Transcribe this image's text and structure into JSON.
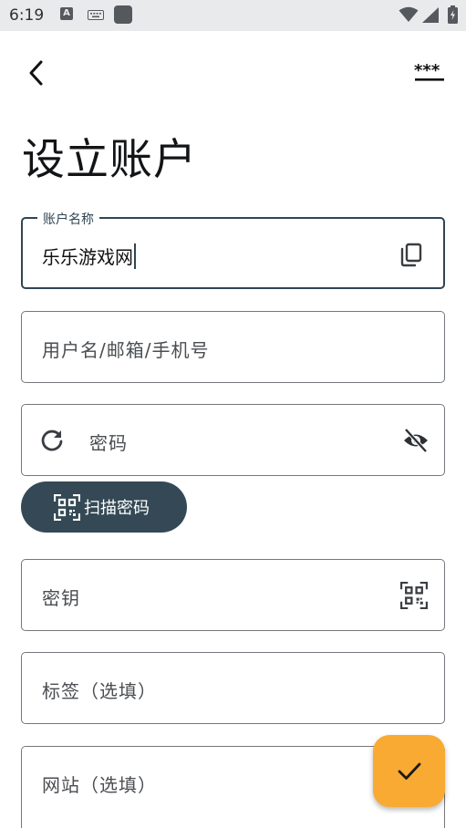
{
  "status_bar": {
    "time": "6:19",
    "icons": [
      "accessibility-a-icon",
      "keyboard-icon",
      "app-square-icon",
      "wifi-icon",
      "signal-icon",
      "battery-icon"
    ]
  },
  "toolbar": {
    "back_icon": "arrow-back-icon",
    "more_icon": "more-asterisks-icon"
  },
  "page": {
    "title": "设立账户"
  },
  "form": {
    "account_name": {
      "label": "账户名称",
      "value": "乐乐游戏网",
      "trailing_icon": "copy-icon"
    },
    "username": {
      "placeholder": "用户名/邮箱/手机号"
    },
    "password": {
      "placeholder": "密码",
      "leading_icon": "refresh-icon",
      "trailing_icon": "visibility-off-icon"
    },
    "scan_password": {
      "label": "扫描密码",
      "icon": "qr-scan-icon"
    },
    "secret_key": {
      "placeholder": "密钥",
      "trailing_icon": "qr-scan-icon"
    },
    "tags": {
      "placeholder": "标签（选填）"
    },
    "website": {
      "placeholder": "网站（选填）"
    }
  },
  "fab": {
    "icon": "check-icon"
  },
  "colors": {
    "primary": "#344955",
    "accent": "#f9aa33",
    "status_bar_bg": "#e9eaec",
    "outline": "#74777b"
  }
}
